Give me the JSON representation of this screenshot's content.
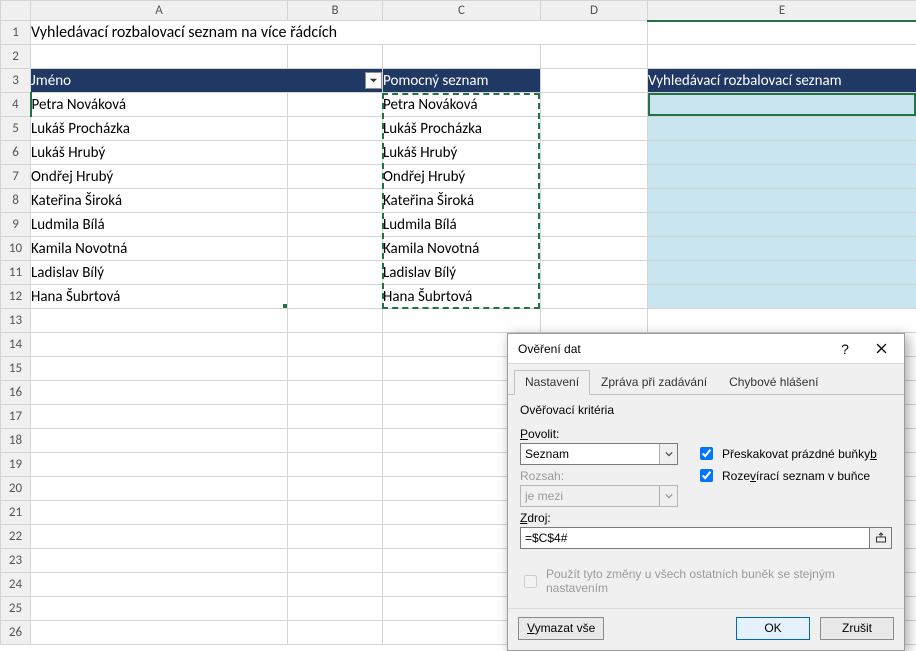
{
  "columns": [
    "A",
    "B",
    "C",
    "D",
    "E"
  ],
  "rows_count": 26,
  "title_cell": "Vyhledávací rozbalovací seznam na více řádcích",
  "headers": {
    "A3": "Jméno",
    "C3": "Pomocný seznam",
    "E3": "Vyhledávací rozbalovací seznam"
  },
  "names": [
    "Petra Nováková",
    "Lukáš Procházka",
    "Lukáš Hrubý",
    "Ondřej Hrubý",
    "Kateřina Široká",
    "Ludmila Bílá",
    "Kamila Novotná",
    "Ladislav Bílý",
    "Hana Šubrtová"
  ],
  "selected_cell": "E4",
  "highlight_range": "E4:E12",
  "marching_range": "C4:C12",
  "dialog": {
    "title": "Ověření dat",
    "tabs": [
      "Nastavení",
      "Zpráva při zadávání",
      "Chybové hlášení"
    ],
    "active_tab": 0,
    "group_label": "Ověřovací kritéria",
    "allow_label": "Povolit:",
    "allow_value": "Seznam",
    "range_label": "Rozsah:",
    "range_value": "je mezi",
    "source_label": "Zdroj:",
    "source_value": "=$C$4#",
    "skip_blanks_label": "Přeskakovat prázdné buňky",
    "skip_blanks_checked": true,
    "incell_label": "Rozevírací seznam v buňce",
    "incell_checked": true,
    "apply_all_label": "Použít tyto změny u všech ostatních buněk se stejným nastavením",
    "apply_all_checked": false,
    "clear_all": "Vymazat vše",
    "ok": "OK",
    "cancel": "Zrušit",
    "allow_underline_char": "P",
    "source_underline_char": "Z",
    "skip_underline_char": "b",
    "incell_underline_char": "v",
    "clear_underline_char": "V"
  },
  "col_widths": {
    "A": 257,
    "B": 95,
    "C": 158,
    "D": 107,
    "E": 269
  }
}
